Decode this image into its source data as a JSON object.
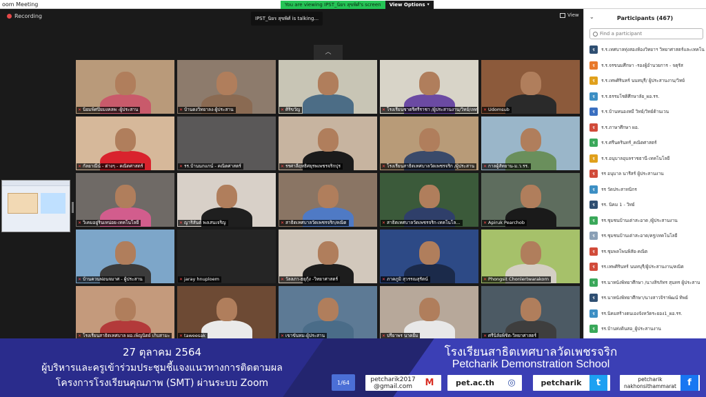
{
  "window": {
    "title": "oom Meeting"
  },
  "share_banner": {
    "message": "You are viewing IPST_นิยร สุขพิศ์'s screen",
    "view_options": "View Options"
  },
  "toolbar": {
    "recording": "Recording",
    "talking": "IPST_นิยร สุขพิศ์ is talking...",
    "view": "View"
  },
  "tiles": [
    {
      "name": "นิยมพิศปิยมงคลพ -ผู้ประสาน",
      "muted": true,
      "bg": "#b99a7a",
      "body": "#c95a6b",
      "head": true
    },
    {
      "name": "บ้านดงวิทยาลง-ผู้ประสาน",
      "muted": true,
      "bg": "#8d7b6c",
      "body": "#8a6a52",
      "head": true
    },
    {
      "name": "ศิริขวัญ",
      "muted": true,
      "bg": "#c8c5b5",
      "body": "#4c6d86",
      "head": true
    },
    {
      "name": "โรงเรียนชาตรีศรีราชา /ผู้ประสานงาน/วิทย์/เทค...",
      "muted": true,
      "bg": "#d8d4c8",
      "body": "#6b4aa3",
      "head": true
    },
    {
      "name": "Udomsub",
      "muted": true,
      "bg": "#8c5a3b",
      "body": "#2a2a2a",
      "head": true
    },
    {
      "name": "กัลยาณีน์ - ต่างๆ - คณิตศาสตร์",
      "muted": true,
      "bg": "#d6b89a",
      "body": "#d9232d",
      "head": true
    },
    {
      "name": "รร.บ้านนกแกน์ - คณิตศาสตร์",
      "muted": true,
      "bg": "#5a5858",
      "body": "#4a4a4a",
      "head": false
    },
    {
      "name": "รรศาลีฤทธิศยุรพเพชรจริกปุร",
      "muted": true,
      "bg": "#c7b4a0",
      "body": "#1b1b1b",
      "head": true
    },
    {
      "name": "โรงเรียนสาธิตเทศบาลวัดเพชรจริก /ผู้ประสาน",
      "muted": true,
      "bg": "#b89b78",
      "body": "#3a4a6a",
      "head": true
    },
    {
      "name": "กาลผู้สัทยาน-ม.ว.รร.",
      "muted": true,
      "bg": "#9ab6c9",
      "body": "#6a8f5c",
      "head": true
    },
    {
      "name": "วิเคมอยู่รินเหน่อย-เทคโนโลยี",
      "muted": true,
      "bg": "#6f6a66",
      "body": "#d25d8d",
      "head": true
    },
    {
      "name": "ญาริสันต์ พงเสนเจริญ",
      "muted": true,
      "bg": "#d8d0c8",
      "body": "#1f1f1f",
      "head": true
    },
    {
      "name": "สาธิตเทศบาลวัดเพชรจริก/คณิต",
      "muted": true,
      "bg": "#8a7564",
      "body": "#4f7ac5",
      "head": true
    },
    {
      "name": "สาธิตเทศบาลวัดเพชรจริก-เทคโนโล...",
      "muted": true,
      "bg": "#3b5a3a",
      "body": "#2f3f6a",
      "head": true
    },
    {
      "name": "Apiruk Pearchob",
      "muted": true,
      "bg": "#5e6d5e",
      "body": "#1a1a1a",
      "head": true
    },
    {
      "name": "บ้านควนพ่อนจมาศ - ผู้ประสาน",
      "muted": true,
      "bg": "#7da6c9",
      "body": "#3b3b3b",
      "head": true
    },
    {
      "name": "jaray hnuploem",
      "muted": true,
      "bg": "#252525",
      "body": "#252525",
      "head": false
    },
    {
      "name": "วัลลภา-ธยุกุ้ง -วิทยาศาสตร์",
      "muted": true,
      "bg": "#d2c8bc",
      "body": "#1d1d1d",
      "head": true
    },
    {
      "name": "ภาคภูมิ สุวรรณสุรัตน์",
      "muted": true,
      "bg": "#2d4a86",
      "body": "#1b2a4a",
      "head": true
    },
    {
      "name": "Phongsit Chonlertwarakorn",
      "muted": true,
      "bg": "#a6c16a",
      "body": "#d4cfc4",
      "head": true
    },
    {
      "name": "โรงเรียนสาธิตเทศบาล ผอ.เพ็ญนิตย์ เก็บสามะ",
      "muted": true,
      "bg": "#c49a7c",
      "body": "#b33a3a",
      "head": true
    },
    {
      "name": "taweesak",
      "muted": true,
      "bg": "#6d4a34",
      "body": "#eaeaea",
      "head": true
    },
    {
      "name": "เขาขันทม-ผู้ประสาน",
      "muted": true,
      "bg": "#5d7a95",
      "body": "#4a6c88",
      "head": true
    },
    {
      "name": "ปรียาพร นาคยิ้ม",
      "muted": true,
      "bg": "#b7a89a",
      "body": "#e8e8e8",
      "head": true
    },
    {
      "name": "ศรีนิลัยพิชิต-วิทยาศาสตร์",
      "muted": true,
      "bg": "#4c5a64",
      "body": "#3e3e3e",
      "head": true
    }
  ],
  "participants": {
    "title": "Participants (467)",
    "search_placeholder": "Find a participant",
    "list": [
      {
        "name": "ร.ร.เทศบาลทุ่งสองห้องวิทยาฯ วิทยาศาสตร์และเทคโนโลยี",
        "initial": "ร",
        "color": "#2f4f72"
      },
      {
        "name": "ร.ร.จรขนมศึกษา -รองผู้อำนวยการ - จตุรัส",
        "initial": "ร",
        "color": "#e8792b"
      },
      {
        "name": "ร.ร.เทพศิรินทร์ นนทบุรี/ ผู้ประสานงาน/วิทย์",
        "initial": "ร",
        "color": "#e0a01c"
      },
      {
        "name": "ร.ร.ธรรมโชติศึกษาลัย_ผอ.รร.",
        "initial": "ร",
        "color": "#3d8fc4"
      },
      {
        "name": "ร.ร.บ้านหนองหมี วิทย์/วิทย์ด้านเวน",
        "initial": "ร",
        "color": "#3a6fc0"
      },
      {
        "name": "ร.ร.ภาษาศึกษา ผอ.",
        "initial": "ร",
        "color": "#d14b3a"
      },
      {
        "name": "ร.ร.ศรีนครินทร์_คณิตศาสตร์",
        "initial": "ร",
        "color": "#3aa85a"
      },
      {
        "name": "ร.ร.อนุบาลอุบลราชธานี-เทคโนโลยี",
        "initial": "ร",
        "color": "#e0a01c"
      },
      {
        "name": "รร อนุบาล นารีสร์ ผู้ประสานงาน",
        "initial": "ร",
        "color": "#d14b3a"
      },
      {
        "name": "รร วัดประสาทนิกร",
        "initial": "ร",
        "color": "#3d8fc4"
      },
      {
        "name": "รร. นิคม 1 - วิทย์",
        "initial": "ร",
        "color": "#2f4f72"
      },
      {
        "name": "รร.ชุมชนบ้านเต่าสะอาด /ผู้ประสานงาน",
        "initial": "ร",
        "color": "#3aa85a"
      },
      {
        "name": "รร.ชุมชนบ้านเต่าสะอาด/ครู/เทคโนโลยี",
        "initial": "ร",
        "color": "#8aa0b6"
      },
      {
        "name": "รร.ชุมพลโพนพิสัย-คณิต",
        "initial": "ร",
        "color": "#d14b3a"
      },
      {
        "name": "รร.เทพศิรินทร์ นนทบุรี/ผู้ประสานงาน/คณิต",
        "initial": "ร",
        "color": "#d14b3a"
      },
      {
        "name": "รร.นาหนังพิทยาศึกษา /นางสิรภัทร สุนทร ผู้ประสาน",
        "initial": "ร",
        "color": "#3aa85a"
      },
      {
        "name": "รร.นาหนังพิทยาศึกษา/นางสาวจิราพัฒน์ ทิพย์",
        "initial": "ร",
        "color": "#2f4f72"
      },
      {
        "name": "รร.นิคมสร้างตนเองจังหวัดระยอง1_ผอ.รร.",
        "initial": "ร",
        "color": "#3d8fc4"
      },
      {
        "name": "รร.บ้านท่งดินสอ_ผู้ประสานงาน",
        "initial": "ร",
        "color": "#3aa85a"
      }
    ]
  },
  "footer": {
    "date": "27 ตุลาคม 2564",
    "line2": "ผู้บริหารและครูเข้าร่วมประชุมชี้แจงแนวทางการติดตามผล",
    "line3": "โครงการโรงเรียนคุณภาพ (SMT) ผ่านระบบ Zoom",
    "school_th": "โรงเรียนสาธิตเทศบาลวัดเพชรจริก",
    "school_en": "Petcharik Demonstration School",
    "page": "1/64",
    "email_1": "petcharik2017",
    "email_2": "@gmail.com",
    "website": "pet.ac.th",
    "twitter": "petcharik",
    "facebook_1": "petcharik",
    "facebook_2": "nakhonsithammarat"
  }
}
